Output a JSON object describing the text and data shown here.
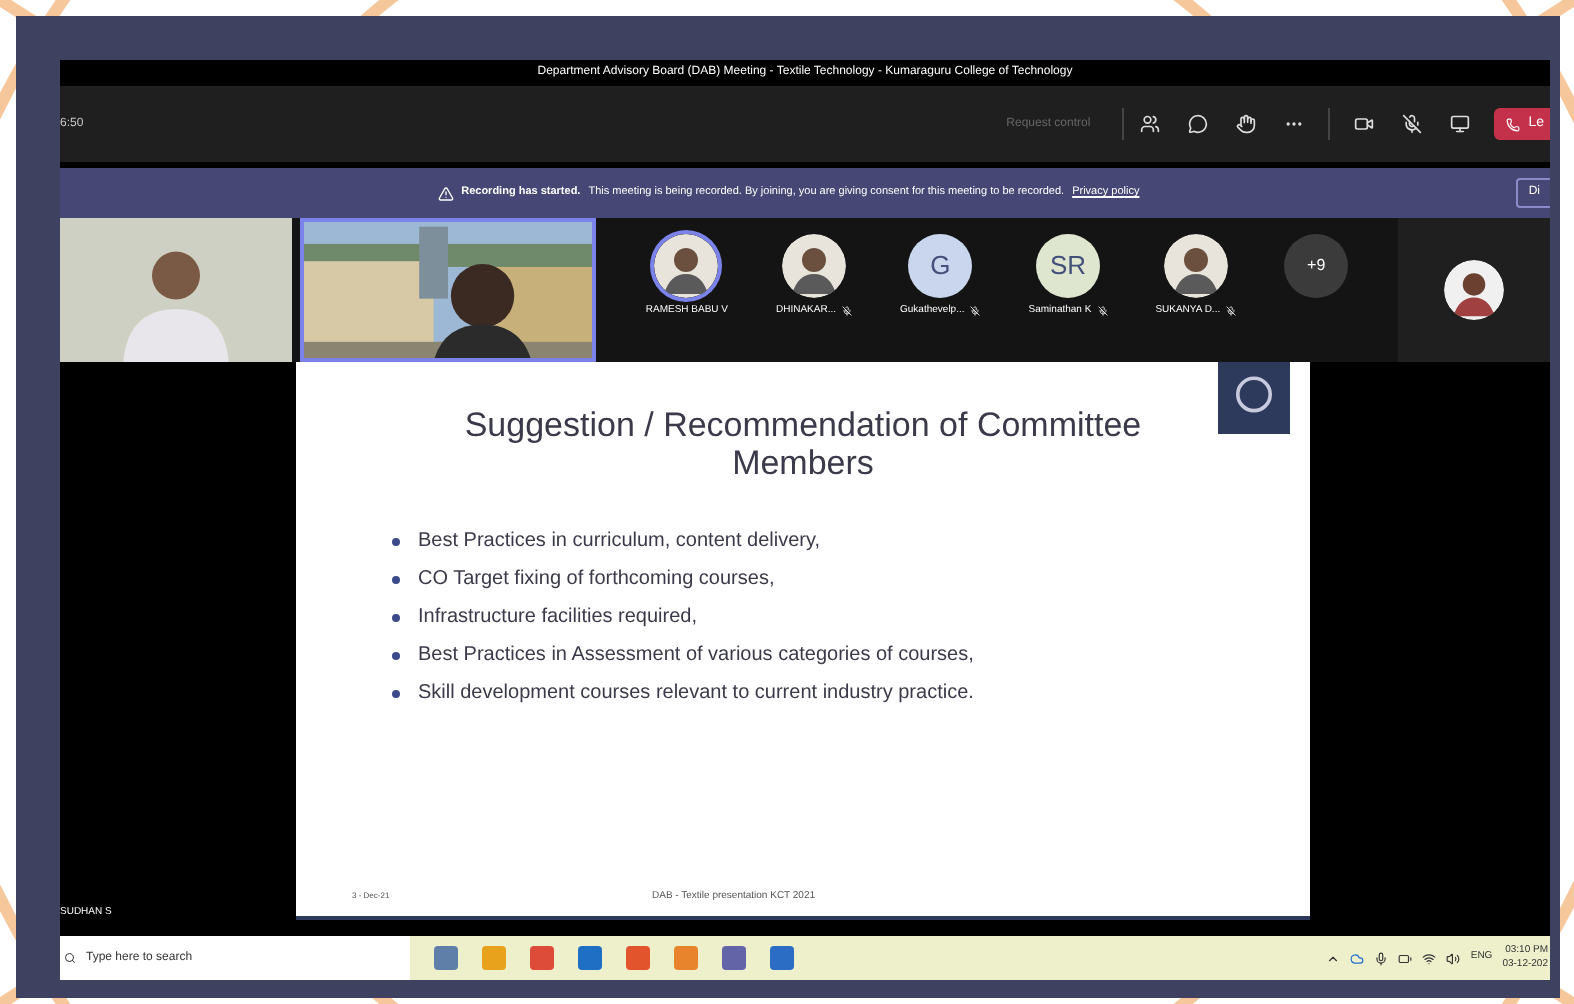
{
  "window": {
    "title": "Department Advisory Board (DAB) Meeting - Textile Technology - Kumaraguru College of Technology"
  },
  "toolbar": {
    "timer": "6:50",
    "request_control": {
      "label": "Request control",
      "disabled": true
    },
    "leave_button": "Le"
  },
  "banner": {
    "title": "Recording has started.",
    "message": "This meeting is being recorded. By joining, you are giving consent for this meeting to be recorded.",
    "link": "Privacy policy",
    "button": "Di"
  },
  "video_tiles": [
    {
      "kind": "picture",
      "selected": false
    },
    {
      "kind": "picture",
      "selected": true
    }
  ],
  "participants": [
    {
      "name": "RAMESH BABU V",
      "speaking": true,
      "muted": false
    },
    {
      "name": "DHINAKAR...",
      "speaking": false,
      "muted": true
    },
    {
      "kind": "initials",
      "initials": "G",
      "name": "Gukathevelp...",
      "color": "#c9d6ee",
      "speaking": false,
      "muted": true
    },
    {
      "kind": "initials",
      "initials": "SR",
      "name": "Saminathan K",
      "color": "#dfe6cf",
      "speaking": false,
      "muted": true
    },
    {
      "name": "SUKANYA D...",
      "speaking": false,
      "muted": true
    },
    {
      "kind": "overflow",
      "initials": "+9"
    }
  ],
  "presenter_name": "SUDHAN S",
  "slide": {
    "title": "Suggestion / Recommendation of Committee Members",
    "bullets": [
      "Best Practices in curriculum, content delivery,",
      "CO Target fixing of forthcoming courses,",
      "Infrastructure facilities required,",
      "Best Practices in Assessment of various categories of courses,",
      "Skill development courses relevant to current industry practice."
    ],
    "date": "3 - Dec-21",
    "footer": "DAB - Textile presentation KCT 2021"
  },
  "taskbar": {
    "search_placeholder": "Type here to search",
    "language": "ENG",
    "time": "03:10 PM",
    "date": "03-12-202"
  }
}
